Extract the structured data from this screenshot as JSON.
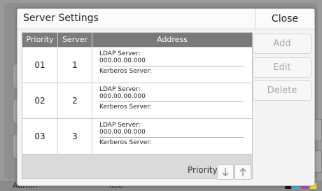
{
  "dialog": {
    "title": "Server Settings",
    "close_label": "Close"
  },
  "table": {
    "headers": {
      "priority": "Priority",
      "server": "Server",
      "address": "Address"
    },
    "rows": [
      {
        "priority": "01",
        "server": "1",
        "ldap_label": "LDAP Server:",
        "ldap_value": "000.00.00.000",
        "kerberos_label": "Kerberos Server:"
      },
      {
        "priority": "02",
        "server": "2",
        "ldap_label": "LDAP Server:",
        "ldap_value": "000.00.00.000",
        "kerberos_label": "Kerberos Server:"
      },
      {
        "priority": "03",
        "server": "3",
        "ldap_label": "LDAP Server:",
        "ldap_value": "000.00.00.000",
        "kerberos_label": "Kerberos Server:"
      }
    ]
  },
  "footer": {
    "priority_label": "Priority",
    "down_icon": "arrow-down-icon",
    "up_icon": "arrow-up-icon"
  },
  "actions": {
    "add": "Add",
    "edit": "Edit",
    "delete": "Delete"
  },
  "status_bar": {
    "user": "Admin",
    "state": "Idle",
    "ink_colors": [
      "#1a1a1a",
      "#36b6e8",
      "#d63aa0",
      "#f2e02a"
    ]
  },
  "colors": {
    "header_gray": "#7a7a7a",
    "disabled_text": "#a8a8a8"
  }
}
